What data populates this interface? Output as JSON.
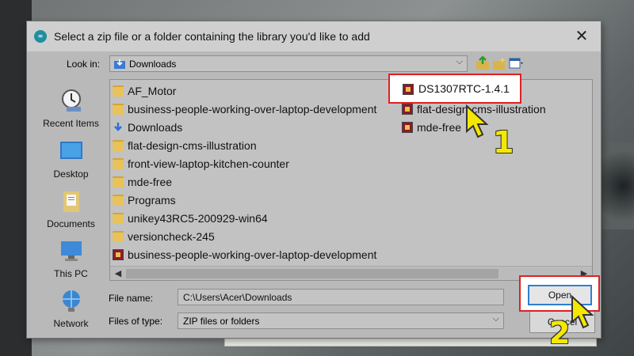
{
  "dialog": {
    "title": "Select a zip file or a folder containing the library you'd like to add",
    "app_icon_text": "∞",
    "close": "✕"
  },
  "lookin": {
    "label": "Look in:",
    "value": "Downloads"
  },
  "places": [
    {
      "label": "Recent Items",
      "icon": "recent-items-icon"
    },
    {
      "label": "Desktop",
      "icon": "desktop-icon"
    },
    {
      "label": "Documents",
      "icon": "documents-icon"
    },
    {
      "label": "This PC",
      "icon": "this-pc-icon"
    },
    {
      "label": "Network",
      "icon": "network-icon"
    }
  ],
  "files_col1": [
    {
      "name": "AF_Motor",
      "type": "folder"
    },
    {
      "name": "business-people-working-over-laptop-development",
      "type": "folder"
    },
    {
      "name": "Downloads",
      "type": "download-folder"
    },
    {
      "name": "flat-design-cms-illustration",
      "type": "folder"
    },
    {
      "name": "front-view-laptop-kitchen-counter",
      "type": "folder"
    },
    {
      "name": "mde-free",
      "type": "folder"
    },
    {
      "name": "Programs",
      "type": "folder"
    },
    {
      "name": "unikey43RC5-200929-win64",
      "type": "folder"
    },
    {
      "name": "versioncheck-245",
      "type": "folder"
    },
    {
      "name": "business-people-working-over-laptop-development",
      "type": "zip"
    }
  ],
  "files_col2": [
    {
      "name": "DS1307RTC-1.4.1",
      "type": "zip"
    },
    {
      "name": "flat-design-cms-illustration",
      "type": "zip"
    },
    {
      "name": "mde-free",
      "type": "zip"
    }
  ],
  "form": {
    "file_name_label": "File name:",
    "file_name_value": "C:\\Users\\Acer\\Downloads",
    "file_type_label": "Files of type:",
    "file_type_value": "ZIP files or folders",
    "open": "Open",
    "cancel": "Cancel"
  },
  "annotations": {
    "step1": "1",
    "step2": "2",
    "highlight_color": "#e02020",
    "number_color": "#f5e800"
  }
}
